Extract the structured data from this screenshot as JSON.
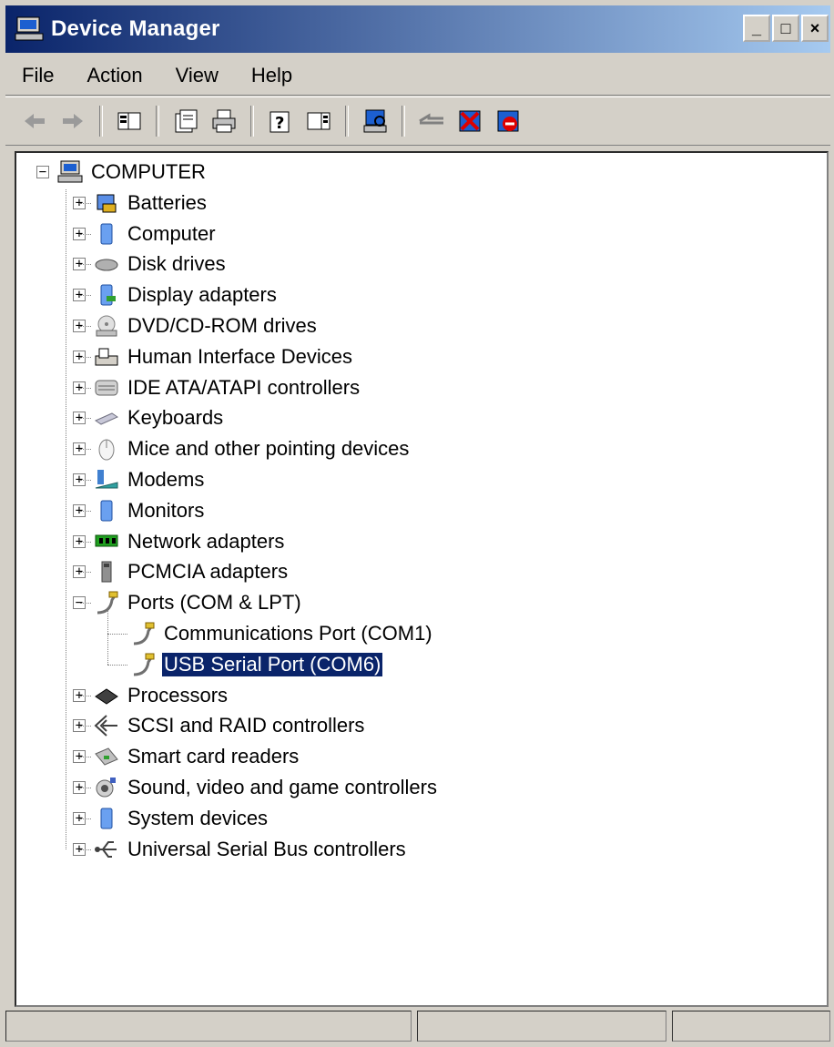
{
  "window": {
    "title": "Device Manager"
  },
  "titlebar_buttons": {
    "minimize": "_",
    "maximize": "□",
    "close": "×"
  },
  "menu": [
    "File",
    "Action",
    "View",
    "Help"
  ],
  "toolbar": [
    "back-icon",
    "forward-icon",
    "show-hide-tree-icon",
    "properties-icon",
    "print-icon",
    "help-icon",
    "show-action-pane-icon",
    "scan-hardware-icon",
    "update-driver-icon",
    "uninstall-icon",
    "disable-icon"
  ],
  "tree": {
    "root": "COMPUTER",
    "items": [
      {
        "label": "Batteries",
        "icon": "battery-icon"
      },
      {
        "label": "Computer",
        "icon": "computer-icon"
      },
      {
        "label": "Disk drives",
        "icon": "disk-drive-icon"
      },
      {
        "label": "Display adapters",
        "icon": "display-adapter-icon"
      },
      {
        "label": "DVD/CD-ROM drives",
        "icon": "dvd-icon"
      },
      {
        "label": "Human Interface Devices",
        "icon": "hid-icon"
      },
      {
        "label": "IDE ATA/ATAPI controllers",
        "icon": "ide-controller-icon"
      },
      {
        "label": "Keyboards",
        "icon": "keyboard-icon"
      },
      {
        "label": "Mice and other pointing devices",
        "icon": "mouse-icon"
      },
      {
        "label": "Modems",
        "icon": "modem-icon"
      },
      {
        "label": "Monitors",
        "icon": "monitor-icon"
      },
      {
        "label": "Network adapters",
        "icon": "network-adapter-icon"
      },
      {
        "label": "PCMCIA adapters",
        "icon": "pcmcia-icon"
      },
      {
        "label": "Ports (COM & LPT)",
        "icon": "port-icon",
        "expanded": true,
        "children": [
          {
            "label": "Communications Port (COM1)",
            "icon": "port-icon"
          },
          {
            "label": "USB Serial Port (COM6)",
            "icon": "port-icon",
            "selected": true
          }
        ]
      },
      {
        "label": "Processors",
        "icon": "processor-icon"
      },
      {
        "label": "SCSI and RAID controllers",
        "icon": "scsi-icon"
      },
      {
        "label": "Smart card readers",
        "icon": "smart-card-icon"
      },
      {
        "label": "Sound, video and game controllers",
        "icon": "sound-icon"
      },
      {
        "label": "System devices",
        "icon": "system-devices-icon"
      },
      {
        "label": "Universal Serial Bus controllers",
        "icon": "usb-icon"
      }
    ]
  },
  "colors": {
    "title_start": "#0a246a",
    "title_end": "#a6caf0",
    "selection": "#0a246a",
    "face": "#d4d0c8"
  }
}
